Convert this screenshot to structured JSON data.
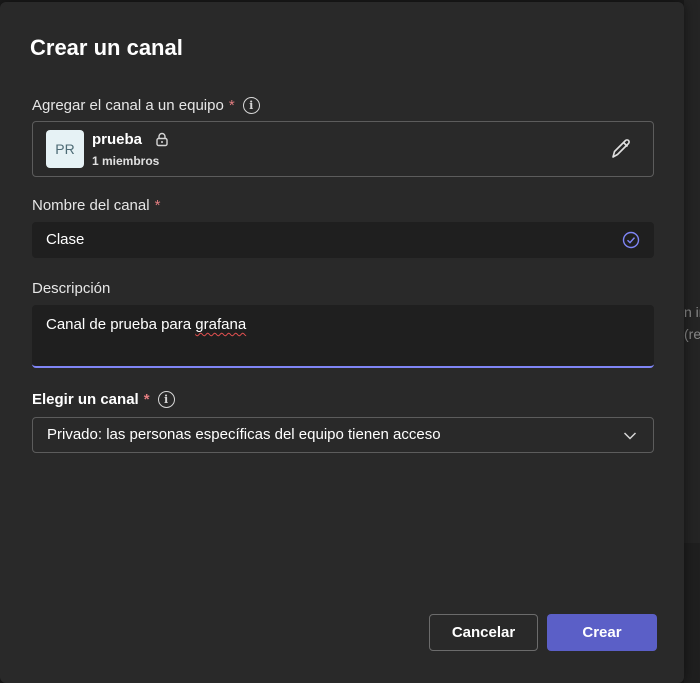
{
  "background": {
    "fragment_1": "n in",
    "fragment_2": "(re"
  },
  "dialog": {
    "title": "Crear un canal",
    "team_section": {
      "label": "Agregar el canal a un equipo",
      "required": "*",
      "info_glyph": "i",
      "team": {
        "initials": "PR",
        "name": "prueba",
        "members": "1 miembros"
      }
    },
    "name_section": {
      "label": "Nombre del canal",
      "required": "*",
      "value": "Clase"
    },
    "description_section": {
      "label": "Descripción",
      "value_prefix": "Canal de prueba para ",
      "value_misspelled": "grafana"
    },
    "privacy_section": {
      "label": "Elegir un canal",
      "required": "*",
      "info_glyph": "i",
      "selected": "Privado: las personas específicas del equipo tienen acceso"
    },
    "buttons": {
      "cancel": "Cancelar",
      "create": "Crear"
    }
  },
  "colors": {
    "accent": "#5b5fc7",
    "focus_underline": "#7f85f5",
    "required": "#e37d80",
    "dialog_bg": "#292929",
    "input_bg": "#1f1f1f"
  },
  "icons": {
    "info": "info-icon",
    "lock": "lock-icon",
    "edit": "pencil-icon",
    "valid": "check-circle-icon",
    "dropdown": "chevron-down-icon"
  }
}
